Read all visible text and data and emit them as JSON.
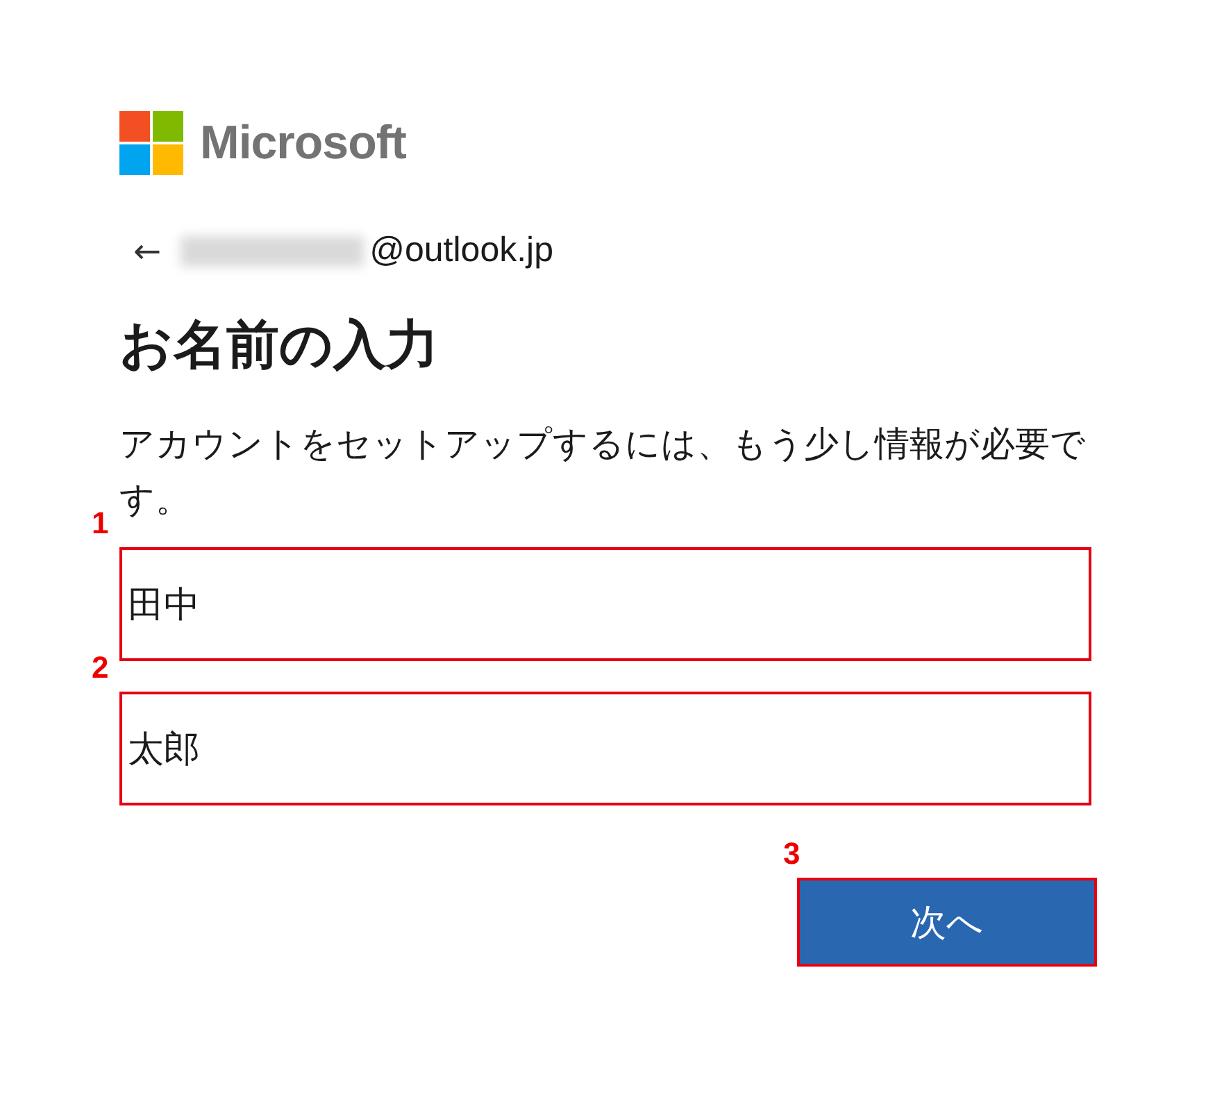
{
  "logo": {
    "name": "Microsoft"
  },
  "account": {
    "back": "←",
    "email_domain": "@outlook.jp",
    "user_blurred": true
  },
  "title": "お名前の入力",
  "description": "アカウントをセットアップするには、もう少し情報が必要です。",
  "fields": [
    {
      "marker": "1",
      "value": "田中"
    },
    {
      "marker": "2",
      "value": "太郎"
    }
  ],
  "next_button": {
    "marker": "3",
    "label": "次へ"
  }
}
